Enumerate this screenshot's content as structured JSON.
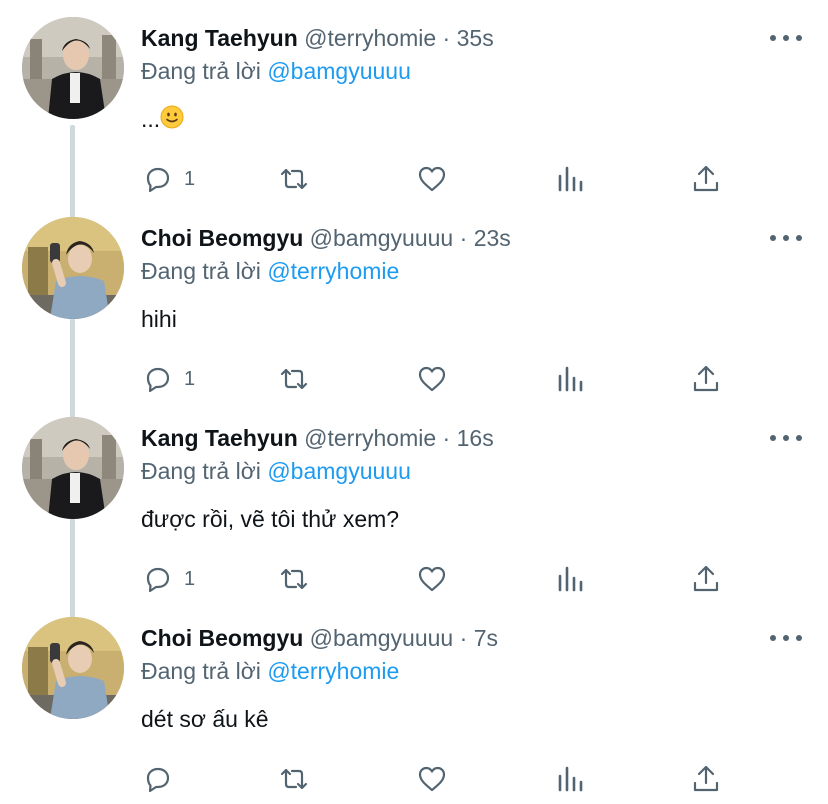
{
  "tweets": [
    {
      "name": "Kang Taehyun",
      "handle": "@terryhomie",
      "dot": "·",
      "time": "35s",
      "replying_prefix": "Đang trả lời ",
      "mention": "@bamgyuuuu",
      "text": "...",
      "emoji": "slightly-smiling-face",
      "reply_count": "1"
    },
    {
      "name": "Choi Beomgyu",
      "handle": "@bamgyuuuu",
      "dot": "·",
      "time": "23s",
      "replying_prefix": "Đang trả lời ",
      "mention": "@terryhomie",
      "text": "hihi",
      "reply_count": "1"
    },
    {
      "name": "Kang Taehyun",
      "handle": "@terryhomie",
      "dot": "·",
      "time": "16s",
      "replying_prefix": "Đang trả lời ",
      "mention": "@bamgyuuuu",
      "text": "được rồi, vẽ tôi thử xem?",
      "reply_count": "1"
    },
    {
      "name": "Choi Beomgyu",
      "handle": "@bamgyuuuu",
      "dot": "·",
      "time": "7s",
      "replying_prefix": "Đang trả lời ",
      "mention": "@terryhomie",
      "text": "dét sơ ấu kê",
      "reply_count": ""
    }
  ],
  "icons": {
    "reply": "reply-icon",
    "retweet": "retweet-icon",
    "like": "heart-icon",
    "stats": "stats-icon",
    "share": "share-icon",
    "more": "more-icon"
  },
  "colors": {
    "text": "#0f1419",
    "secondary": "#536471",
    "link": "#1d9bf0",
    "thread_line": "#cfd9de"
  }
}
